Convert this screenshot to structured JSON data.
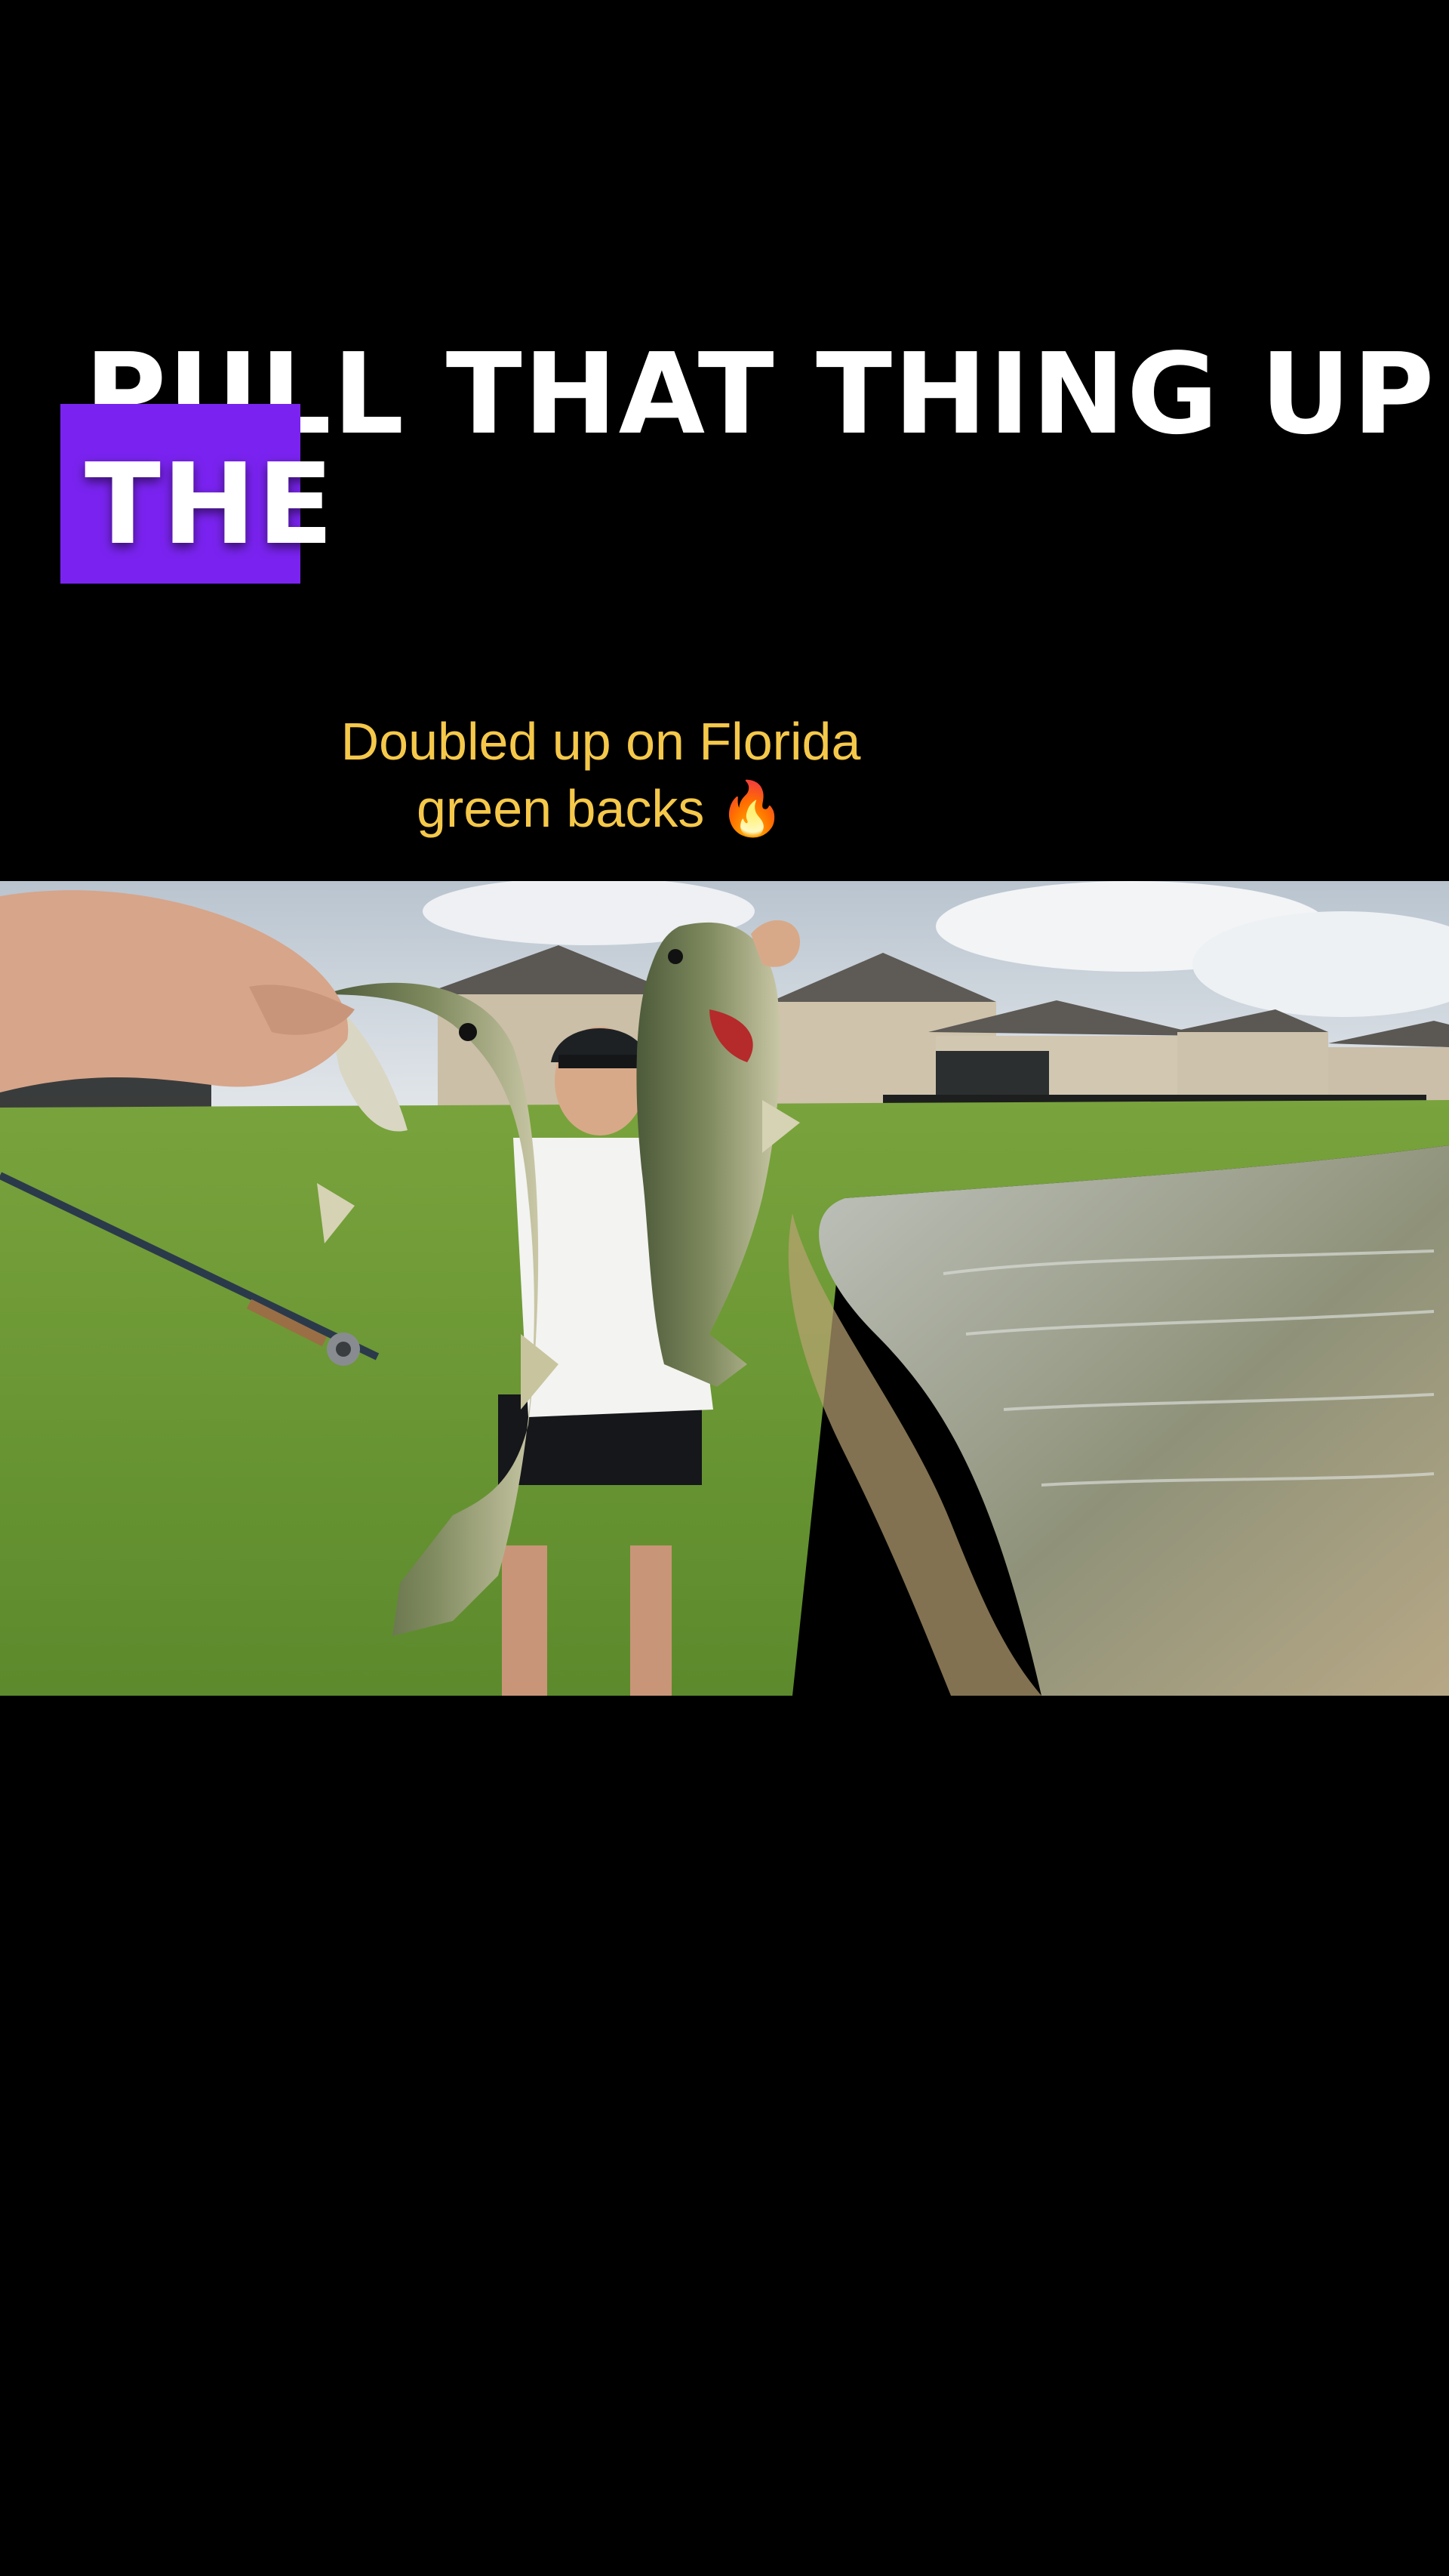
{
  "caption": {
    "line_1": "PULL THAT THING UP",
    "line_2": "THE",
    "highlight_color": "#7a23f0",
    "text_color": "#ffffff"
  },
  "subtitle": {
    "line_1": "Doubled up on Florida",
    "line_2": "green backs 🔥",
    "text_color": "#f5c84a"
  },
  "photo": {
    "icon": "fishing-photo-icon"
  }
}
